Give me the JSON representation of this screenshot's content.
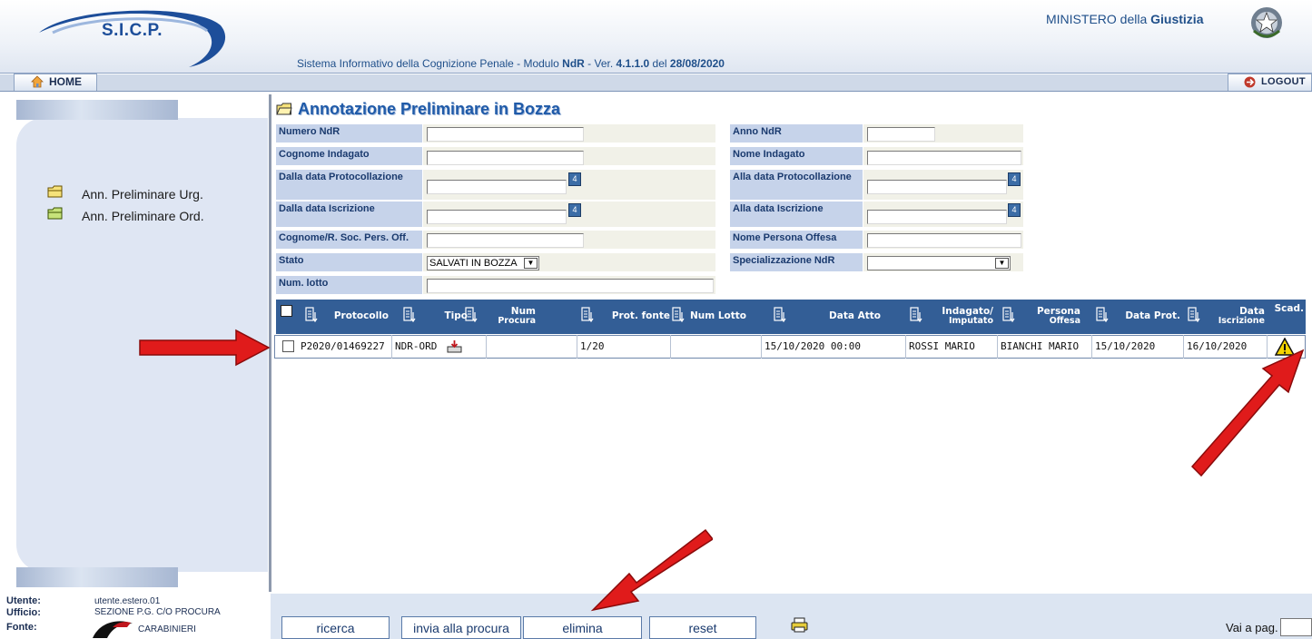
{
  "header": {
    "logo": "S.I.C.P.",
    "system_title_prefix": "Sistema Informativo della Cognizione Penale - Modulo ",
    "module": "NdR",
    "version_prefix": " - Ver. ",
    "version": "4.1.1.0",
    "version_date_prefix": " del ",
    "version_date": "28/08/2020",
    "ministry_prefix": "MINISTERO della ",
    "ministry_name": "Giustizia"
  },
  "nav": {
    "home_label": "HOME",
    "logout_label": "LOGOUT"
  },
  "sidebar": {
    "items": [
      {
        "label": "Ann. Preliminare Urg."
      },
      {
        "label": "Ann. Preliminare Ord."
      }
    ]
  },
  "page": {
    "title": "Annotazione Preliminare in Bozza"
  },
  "form": {
    "numero_ndr": {
      "label": "Numero NdR",
      "value": ""
    },
    "anno_ndr": {
      "label": "Anno NdR",
      "value": ""
    },
    "cognome_indagato": {
      "label": "Cognome Indagato",
      "value": ""
    },
    "nome_indagato": {
      "label": "Nome Indagato",
      "value": ""
    },
    "dalla_data_prot": {
      "label": "Dalla data Protocollazione",
      "value": ""
    },
    "alla_data_prot": {
      "label": "Alla data Protocollazione",
      "value": ""
    },
    "dalla_data_iscr": {
      "label": "Dalla data Iscrizione",
      "value": ""
    },
    "alla_data_iscr": {
      "label": "Alla data Iscrizione",
      "value": ""
    },
    "cognome_persona_offesa": {
      "label": "Cognome/R. Soc. Pers. Off.",
      "value": ""
    },
    "nome_persona_offesa": {
      "label": "Nome Persona Offesa",
      "value": ""
    },
    "stato": {
      "label": "Stato",
      "value": "SALVATI IN BOZZA"
    },
    "specializzazione": {
      "label": "Specializzazione NdR",
      "value": ""
    },
    "num_lotto": {
      "label": "Num. lotto",
      "value": ""
    },
    "calendar_glyph": "4"
  },
  "table": {
    "headers": {
      "protocollo": "Protocollo",
      "tipo": "Tipo",
      "num_procura_1": "Num",
      "num_procura_2": "Procura",
      "prot_fonte": "Prot. fonte",
      "num_lotto": "Num Lotto",
      "data_atto": "Data Atto",
      "indagato_1": "Indagato/",
      "indagato_2": "Imputato",
      "persona_1": "Persona",
      "persona_2": "Offesa",
      "data_prot": "Data Prot.",
      "data_iscr_1": "Data",
      "data_iscr_2": "Iscrizione",
      "scad": "Scad."
    },
    "rows": [
      {
        "protocollo": "P2020/01469227",
        "tipo": "NDR-ORD",
        "num_procura": "",
        "prot_fonte": "1/20",
        "num_lotto": "",
        "data_atto": "15/10/2020 00:00",
        "indagato": "ROSSI MARIO",
        "persona_offesa": "BIANCHI MARIO",
        "data_prot": "15/10/2020",
        "data_iscrizione": "16/10/2020",
        "scad_icon": "warning-icon"
      }
    ]
  },
  "status": {
    "utente_label": "Utente:",
    "utente_value": "utente.estero.01",
    "ufficio_label": "Ufficio:",
    "ufficio_value": "SEZIONE P.G. C/O PROCURA",
    "fonte_label": "Fonte:",
    "fonte_value": "CARABINIERI"
  },
  "buttons": {
    "ricerca": "ricerca",
    "invia": "invia alla procura",
    "elimina": "elimina",
    "reset": "reset"
  },
  "pagination": {
    "vai_label": "Vai a pag.",
    "value": ""
  },
  "colors": {
    "accent": "#335e96",
    "arrow": "#e01b1b",
    "warning": "#f5d400"
  }
}
